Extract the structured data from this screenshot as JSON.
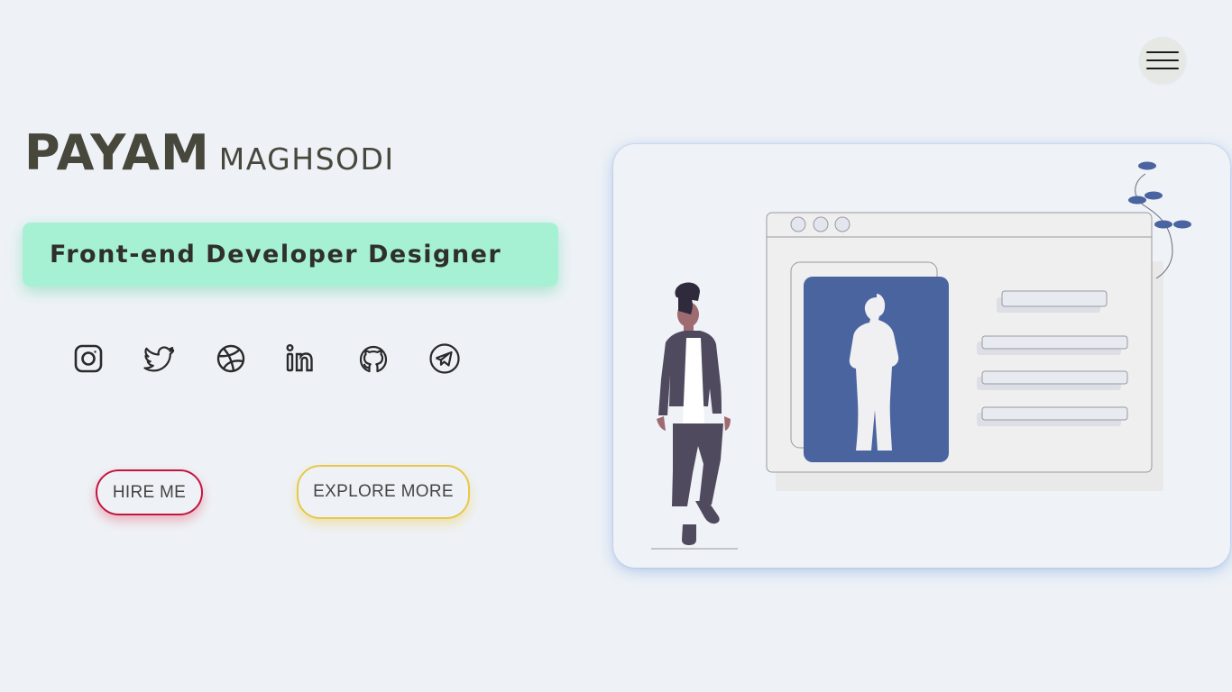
{
  "header": {
    "menu_icon": "hamburger-menu-icon"
  },
  "hero": {
    "first_name": "PAYAM",
    "last_name": "MAGHSODI",
    "role": "Front-end Developer Designer"
  },
  "social": [
    {
      "icon": "instagram-icon"
    },
    {
      "icon": "twitter-icon"
    },
    {
      "icon": "dribbble-icon"
    },
    {
      "icon": "linkedin-icon"
    },
    {
      "icon": "github-icon"
    },
    {
      "icon": "telegram-icon"
    }
  ],
  "buttons": {
    "hire_label": "HIRE ME",
    "explore_label": "EXPLORE MORE"
  },
  "colors": {
    "background": "#eef2f7",
    "role_bg": "#a6f1d4",
    "hire_border": "#c2163f",
    "explore_border": "#e6c84a",
    "illustration_accent": "#4a64a0"
  }
}
